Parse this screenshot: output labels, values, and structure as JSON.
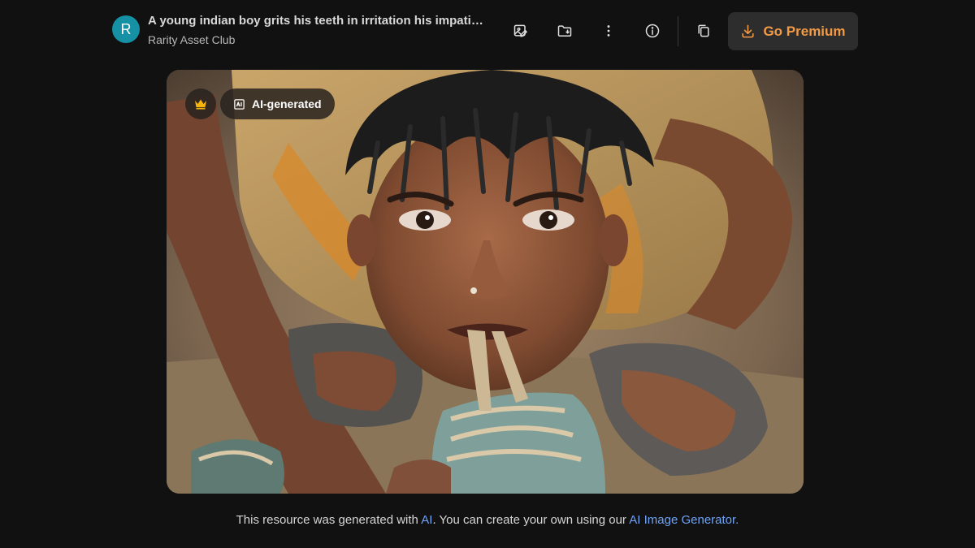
{
  "header": {
    "avatar_initial": "R",
    "avatar_color": "#1690a4",
    "title": "A young indian boy grits his teeth in irritation his impatien...",
    "author": "Rarity Asset Club",
    "actions": [
      {
        "icon": "edit-image-icon"
      },
      {
        "icon": "save-to-folder-icon"
      },
      {
        "icon": "more-vertical-icon"
      },
      {
        "icon": "info-icon"
      },
      {
        "icon": "copy-icon"
      }
    ],
    "premium_label": "Go Premium",
    "premium_color": "#f39a45"
  },
  "image": {
    "badge_crown_icon": "crown-icon",
    "badge_crown_color": "#f5b50a",
    "ai_badge_label": "AI-generated",
    "ai_badge_icon": "ai-image-icon"
  },
  "footer": {
    "text_before": "This resource was generated with",
    "ai_link": "AI",
    "text_middle": ". You can create your own using our",
    "generator_link": "AI Image Generator.",
    "link_color": "#6fa3f5"
  }
}
